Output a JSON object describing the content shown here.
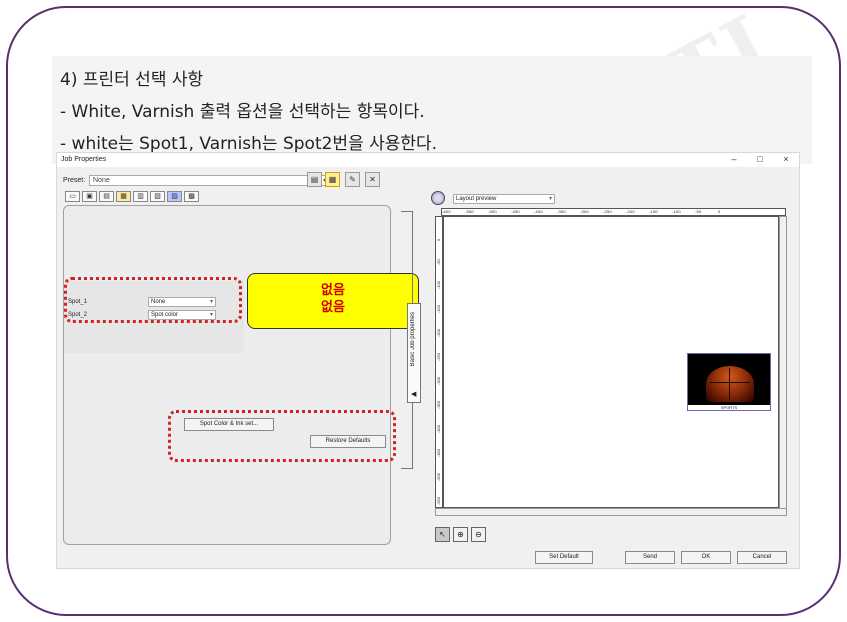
{
  "slide": {
    "watermark": "ENTI",
    "note_lines": [
      "4) 프린터 선택 사항",
      "- White, Varnish 출력 옵션을 선택하는 항목이다.",
      "- white는 Spot1, Varnish는 Spot2번을 사용한다."
    ]
  },
  "dialog": {
    "title": "Job Properties",
    "window_buttons": [
      "–",
      "□",
      "×"
    ],
    "preset_label": "Preset:",
    "preset_value": "None",
    "toolbar_icons": [
      "save-icon",
      "save-as-icon",
      "edit-icon",
      "delete-icon"
    ],
    "tab_icons": [
      "print-icon",
      "layout-icon",
      "media-icon",
      "color-icon",
      "ink-icon",
      "image-icon",
      "rip-icon",
      "output-icon"
    ],
    "spots": [
      {
        "label": "Spot_1",
        "value": "None"
      },
      {
        "label": "Spot_2",
        "value": "Spot color"
      }
    ],
    "callout": [
      "없음",
      "없음"
    ],
    "spot_color_button": "Spot Color & Ink set...",
    "restore_button": "Restore Defaults",
    "side_tab": "Basic Job properties",
    "preview_mode": "Layout preview",
    "ruler_top": [
      "-600",
      "-550",
      "-500",
      "-450",
      "-400",
      "-350",
      "-300",
      "-250",
      "-200",
      "-150",
      "-100",
      "-50",
      "0"
    ],
    "ruler_left": [
      "0",
      "-50",
      "-100",
      "-150",
      "-200",
      "-250",
      "-300",
      "-350",
      "-400",
      "-450",
      "-500",
      "-550"
    ],
    "image_strip": "SPORTS",
    "zoom_icons": [
      "pointer-icon",
      "zoom-in-icon",
      "zoom-out-icon"
    ],
    "footer_buttons": [
      "Set Default",
      "Send",
      "OK",
      "Cancel"
    ]
  },
  "colors": {
    "frame": "#5b2d73",
    "callout_bg": "#ffff00",
    "callout_text": "#d40000",
    "highlight_dotted": "#d32222"
  }
}
